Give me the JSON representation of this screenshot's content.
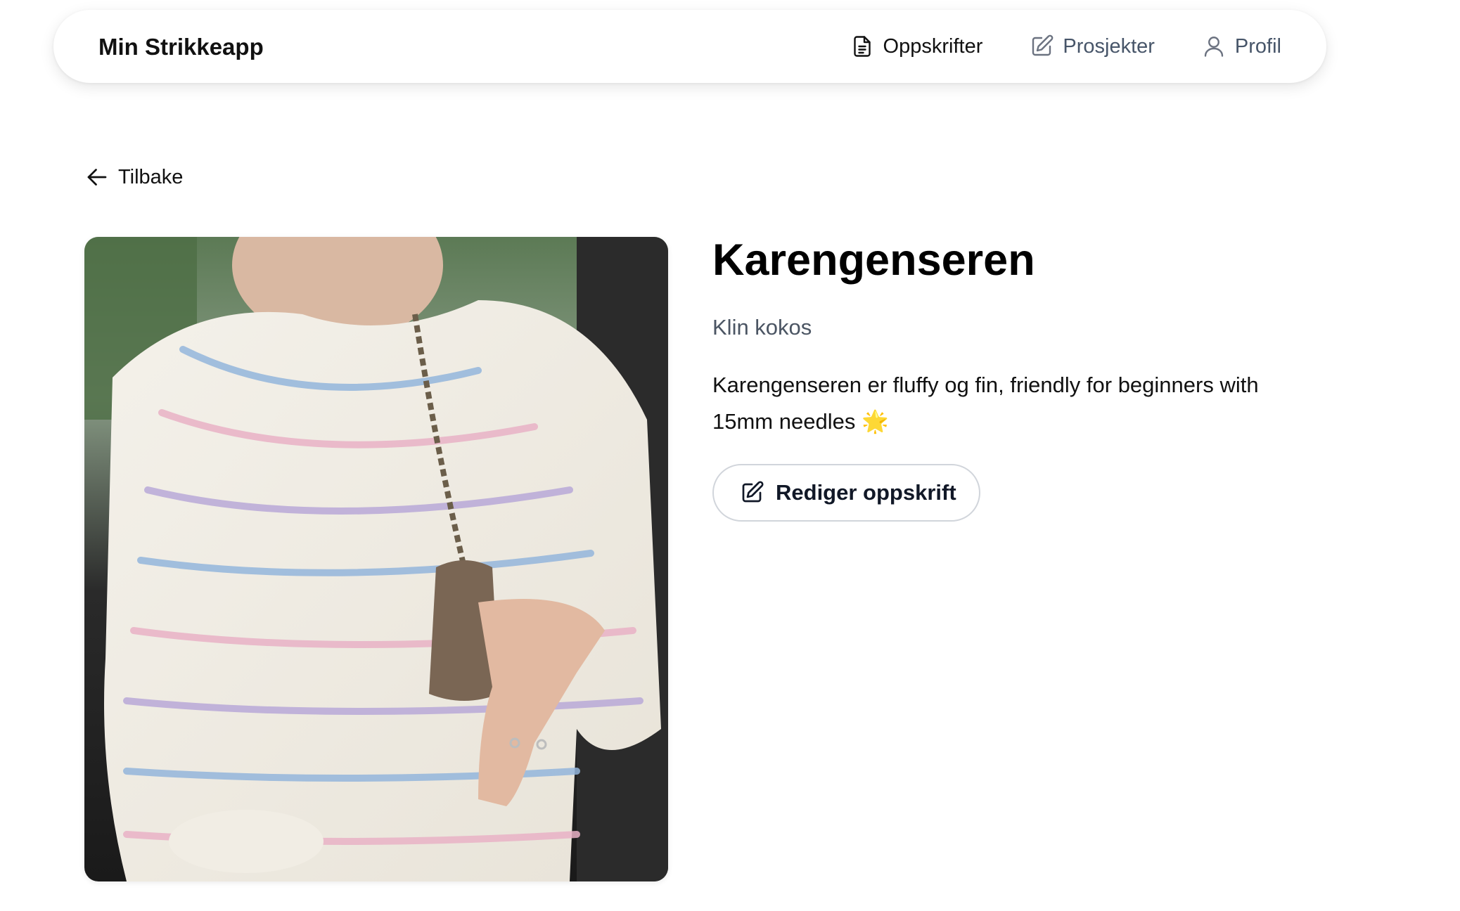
{
  "navbar": {
    "brand": "Min Strikkeapp",
    "items": [
      {
        "label": "Oppskrifter",
        "icon": "document-icon",
        "active": true
      },
      {
        "label": "Prosjekter",
        "icon": "edit-icon",
        "active": false
      },
      {
        "label": "Profil",
        "icon": "user-icon",
        "active": false
      }
    ]
  },
  "back": {
    "label": "Tilbake",
    "icon": "arrow-left-icon"
  },
  "recipe": {
    "title": "Karengenseren",
    "author": "Klin kokos",
    "description": "Karengenseren er fluffy og fin, friendly for beginners with 15mm needles 🌟",
    "image_alt": "Person wearing a fluffy white mohair sweater with pastel blue, pink and purple stripes"
  },
  "actions": {
    "edit_label": "Rediger oppskrift",
    "edit_icon": "edit-icon"
  },
  "colors": {
    "text_primary": "#111111",
    "text_muted": "#4b5563",
    "nav_inactive": "#475569",
    "button_border": "#d1d5db"
  }
}
